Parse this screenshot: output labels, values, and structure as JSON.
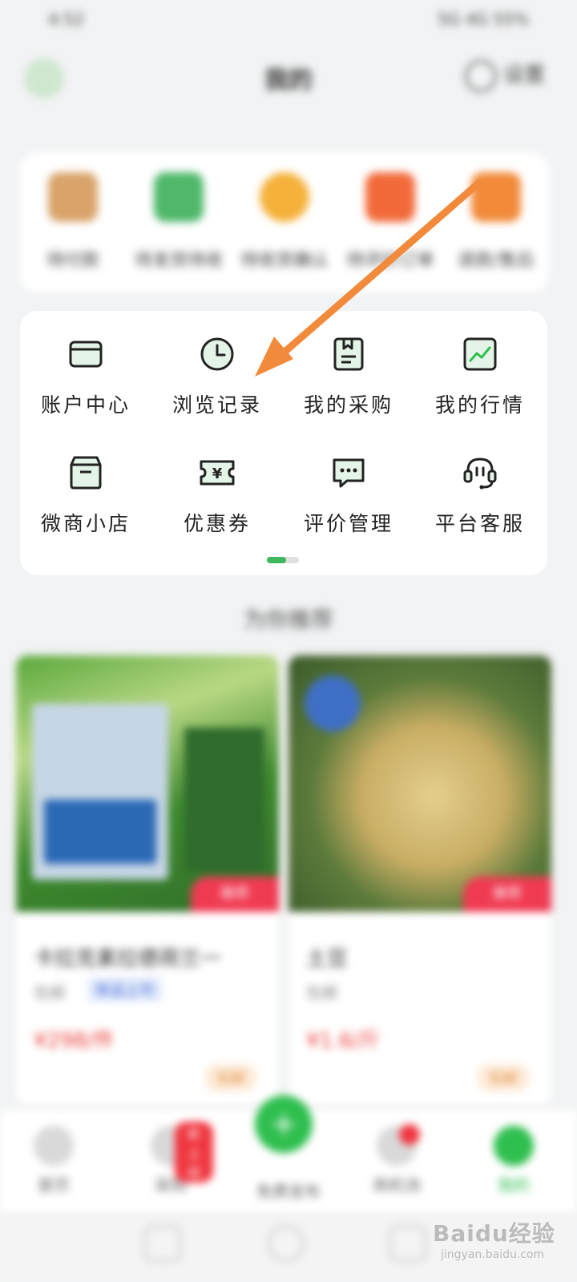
{
  "status_bar": {
    "time": "4:52",
    "right": "5G 4G 55%"
  },
  "header": {
    "title": "我的",
    "settings_label": "设置"
  },
  "orders": [
    {
      "label": "待付款",
      "color": "#d9a36a"
    },
    {
      "label": "待发货待收",
      "color": "#4fb86a"
    },
    {
      "label": "待收货确认",
      "color": "#f5b13a"
    },
    {
      "label": "待评价订单",
      "color": "#f26a3a"
    },
    {
      "label": "退款/售后",
      "color": "#f28a3a"
    }
  ],
  "services": [
    {
      "label": "账户中心",
      "icon": "card-icon"
    },
    {
      "label": "浏览记录",
      "icon": "clock-icon"
    },
    {
      "label": "我的采购",
      "icon": "book-icon"
    },
    {
      "label": "我的行情",
      "icon": "trend-icon"
    },
    {
      "label": "微商小店",
      "icon": "shop-icon"
    },
    {
      "label": "优惠券",
      "icon": "coupon-icon"
    },
    {
      "label": "评价管理",
      "icon": "chat-icon"
    },
    {
      "label": "平台客服",
      "icon": "headset-icon"
    }
  ],
  "recommend_title": "为你推荐",
  "products": [
    {
      "title": "卡拉克素拉德荷兰一",
      "sub": "包邮",
      "badge": "新品上市",
      "price": "¥298/件",
      "tag": "推荐",
      "chip": "包邮"
    },
    {
      "title": "土豆",
      "sub": "包邮",
      "badge": "",
      "price": "¥1.6/斤",
      "tag": "推荐",
      "chip": "包邮"
    }
  ],
  "tabbar": {
    "items": [
      {
        "label": "首页"
      },
      {
        "label": "采购",
        "badge": "新上线"
      },
      {
        "label": "免费发布"
      },
      {
        "label": "商机池"
      },
      {
        "label": "我的"
      }
    ]
  },
  "watermark": {
    "main": "Baidu经验",
    "sub": "jingyan.baidu.com"
  },
  "colors": {
    "accent": "#2fbf4f",
    "arrow": "#f28a3c",
    "price": "#e8403a"
  }
}
